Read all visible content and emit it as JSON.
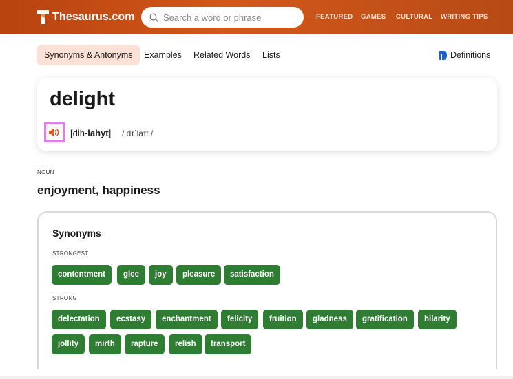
{
  "header": {
    "logo_text": "Thesaurus.com",
    "search_placeholder": "Search a word or phrase",
    "nav": [
      "FEATURED",
      "GAMES",
      "CULTURAL",
      "WRITING TIPS"
    ]
  },
  "tabs": [
    "Synonyms & Antonyms",
    "Examples",
    "Related Words",
    "Lists"
  ],
  "definitions_link": "Definitions",
  "entry": {
    "word": "delight",
    "pron_open": "[dih-",
    "pron_bold": "lahyt",
    "pron_close": "]",
    "ipa": "/ dɪˈlaɪt /"
  },
  "sense": {
    "pos": "NOUN",
    "gloss": "enjoyment, happiness"
  },
  "synonyms": {
    "title": "Synonyms",
    "strongest_label": "STRONGEST",
    "strongest": [
      "contentment",
      "glee",
      "joy",
      "pleasure",
      "satisfaction"
    ],
    "strong_label": "STRONG",
    "strong": [
      "delectation",
      "ecstasy",
      "enchantment",
      "felicity",
      "fruition",
      "gladness",
      "gratification",
      "hilarity",
      "jollity",
      "mirth",
      "rapture",
      "relish",
      "transport"
    ]
  },
  "colors": {
    "header": "#c9531a",
    "chip": "#2e7d32",
    "active_tab": "#fbe1d6",
    "audio_highlight": "#e47ce8",
    "audio_icon": "#e8541b"
  }
}
